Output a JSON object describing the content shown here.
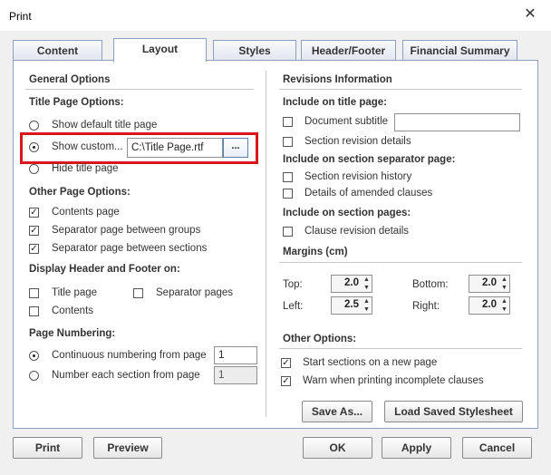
{
  "window": {
    "title": "Print",
    "close_glyph": "✕"
  },
  "tabs": [
    "Content",
    "Layout",
    "Styles",
    "Header/Footer",
    "Financial Summary"
  ],
  "left": {
    "general_options": "General Options",
    "title_page_options": "Title Page Options:",
    "show_default": "Show default title page",
    "show_custom": "Show custom...",
    "custom_path": "C:\\Title Page.rtf",
    "browse_label": "...",
    "hide_title": "Hide title page",
    "other_page_options": "Other Page Options:",
    "contents_page": "Contents page",
    "sep_groups": "Separator page between groups",
    "sep_sections": "Separator page between sections",
    "display_hf": "Display Header and Footer on:",
    "hf_title_page": "Title page",
    "hf_separator": "Separator pages",
    "hf_contents": "Contents",
    "page_numbering": "Page Numbering:",
    "continuous": "Continuous numbering from page",
    "continuous_value": "1",
    "each_section": "Number each section from page",
    "each_section_value": "1"
  },
  "right": {
    "revisions_info": "Revisions Information",
    "include_title": "Include on title page:",
    "doc_subtitle": "Document subtitle",
    "doc_subtitle_value": "",
    "section_rev_details": "Section revision details",
    "include_separator": "Include on section separator page:",
    "section_rev_history": "Section revision history",
    "amended_clauses": "Details of amended clauses",
    "include_section": "Include on section pages:",
    "clause_rev_details": "Clause revision details",
    "margins": "Margins (cm)",
    "top_label": "Top:",
    "top_value": "2.0",
    "bottom_label": "Bottom:",
    "bottom_value": "2.0",
    "left_label": "Left:",
    "left_value": "2.5",
    "right_label": "Right:",
    "right_value": "2.0",
    "other_options": "Other Options:",
    "start_sections": "Start sections on a new page",
    "warn_incomplete": "Warn when printing incomplete clauses",
    "check_glyph": "✓",
    "spin_up": "▲",
    "spin_down": "▼"
  },
  "buttons": {
    "save_as": "Save As...",
    "load_stylesheet": "Load Saved Stylesheet",
    "print": "Print",
    "preview": "Preview",
    "ok": "OK",
    "apply": "Apply",
    "cancel": "Cancel"
  },
  "colors": {
    "highlight": "#d8171c",
    "tab_border": "#8aa0c0"
  }
}
